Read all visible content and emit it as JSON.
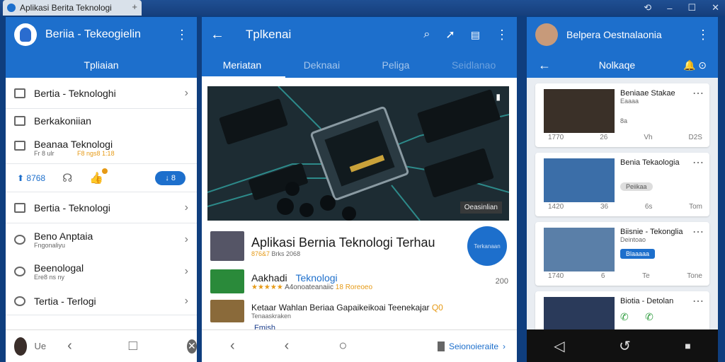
{
  "window": {
    "tab_title": "Aplikasi Berita Teknologi",
    "tab_plus": "+",
    "controls": [
      "⟲",
      "–",
      "☐",
      "✕"
    ]
  },
  "left": {
    "title": "Beriia - Tekeogielin",
    "subtitle": "Tpliaian",
    "items": [
      {
        "label": "Bertia - Teknologhi",
        "chev": "›"
      },
      {
        "label": "Berkakoniian",
        "chev": ""
      },
      {
        "label": "Beanaa Teknologi",
        "sub": "Fr 8 ulr",
        "sub2": "F8 ngs8 1:18",
        "chev": ""
      }
    ],
    "action_count": "8768",
    "action_pill": "↓ 8",
    "items2": [
      {
        "label": "Bertia - Teknologi",
        "sub": "",
        "chev": "›"
      },
      {
        "label": "Beno Anptaia",
        "sub": "Fngonaliyu",
        "chev": "›"
      },
      {
        "label": "Beenologal",
        "sub": "Ere8 ns ny",
        "chev": "›"
      },
      {
        "label": "Tertia - Terlogi",
        "sub": "",
        "chev": "›"
      }
    ],
    "bottom_label": "Ue",
    "nav": [
      "‹",
      "□",
      "✕"
    ]
  },
  "center": {
    "title": "Tplkenai",
    "tabs": [
      "Meriatan",
      "Deknaai",
      "Peliga",
      "Seidlanao"
    ],
    "hero_badge": "Oeasinlian",
    "headline": "Aplikasi Bernia Teknologi Terhau",
    "headline_meta_a": "876&7",
    "headline_meta_b": "Brks 2068",
    "circle_label": "Terkanaan",
    "row2_title_a": "Aakhadi",
    "row2_title_b": "Teknologi",
    "row2_stars": "★★★★★",
    "row2_meta": "A4onoateanaiic",
    "row2_orange": "18 Roreoeo",
    "row2_right": "200",
    "row3_title": "Ketaar Wahlan Beriaa Gapaikeikoai Teenekajar",
    "row3_orange": "Q0",
    "row3_sub": "Tenaaskraken",
    "row4_title": "Fmish",
    "nav_link": "Seionoieraite",
    "nav": [
      "‹",
      "‹",
      "○"
    ]
  },
  "right": {
    "title": "Belpera Oestnalaonia",
    "subtitle": "Nolkaqe",
    "cards": [
      {
        "title": "Beniaae Stakae",
        "sub": "Eaaaa",
        "stat": "8a",
        "meta": [
          "1770",
          "26",
          "Vh",
          "D2S"
        ]
      },
      {
        "title": "Benia Tekaologia",
        "badge": "Peiikaa",
        "meta": [
          "1420",
          "36",
          "6s",
          "Tom"
        ]
      },
      {
        "title": "Biisnie - Tekonglia",
        "sub": "Deintoao",
        "badge": "Blaaaaa",
        "meta": [
          "1740",
          "6",
          "Te",
          "Tone"
        ]
      },
      {
        "title": "Biotia - Detolan",
        "meta": []
      }
    ],
    "nav": [
      "◁",
      "↺",
      "■"
    ]
  }
}
